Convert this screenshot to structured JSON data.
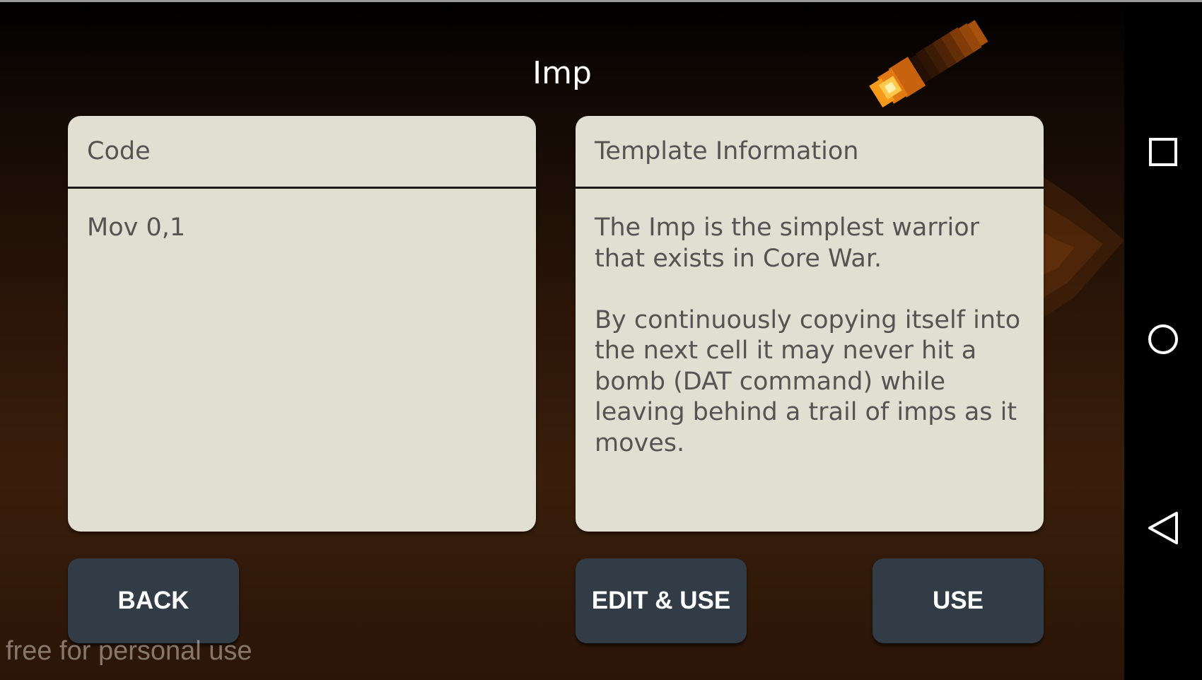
{
  "screen": {
    "title": "Imp"
  },
  "code_panel": {
    "header": "Code",
    "content": "Mov 0,1"
  },
  "info_panel": {
    "header": "Template Information",
    "paragraphs": [
      "The Imp is the simplest warrior that exists in Core War.",
      "By continuously copying itself into the next cell it may never hit a bomb (DAT command) while leaving behind a trail of imps as it moves."
    ]
  },
  "buttons": {
    "back": "BACK",
    "edit_use": "EDIT & USE",
    "use": "USE"
  },
  "watermark": "free for personal use",
  "navigation_bar": {
    "icons": [
      "recents-icon",
      "home-icon",
      "back-icon"
    ]
  },
  "colors": {
    "panel_background": "#e1dfd2",
    "button_background": "#323c47",
    "title_text": "#ffffff",
    "panel_text": "#555453",
    "flame_orange": "#f59a1b"
  }
}
